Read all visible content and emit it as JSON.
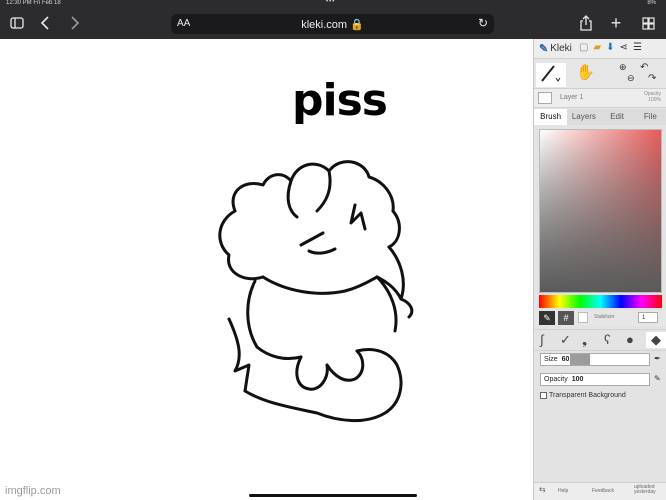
{
  "status": {
    "time": "12:30 PM  Fri Feb 18",
    "dots": "•••",
    "battery": "8%"
  },
  "browser": {
    "text_size": "AA",
    "url": "kleki.com 🔒",
    "icons": [
      "sidebar-icon",
      "back-icon",
      "forward-icon",
      "reload-icon",
      "share-icon",
      "new-tab-icon",
      "tabs-icon"
    ]
  },
  "canvas": {
    "caption": "piss",
    "watermark": "imgflip.com"
  },
  "kleki": {
    "logo": "Kleki",
    "layer": {
      "name": "Layer 1",
      "opacity_label": "Opacity",
      "opacity_value": "100%"
    },
    "tabs": [
      "Brush",
      "Layers",
      "Edit",
      "File"
    ],
    "stabilizer_label": "Stabilizer",
    "stabilizer_value": "1",
    "size": {
      "label": "Size",
      "value": "60",
      "fraction": 0.45
    },
    "opacity": {
      "label": "Opacity",
      "value": "100",
      "fraction": 0.0
    },
    "transparent_bg": "Transparent Background",
    "bottom": {
      "help": "Help",
      "feedback": "Feedback",
      "saved": "uploaded yesterday"
    },
    "accent": "#e85a5a"
  }
}
